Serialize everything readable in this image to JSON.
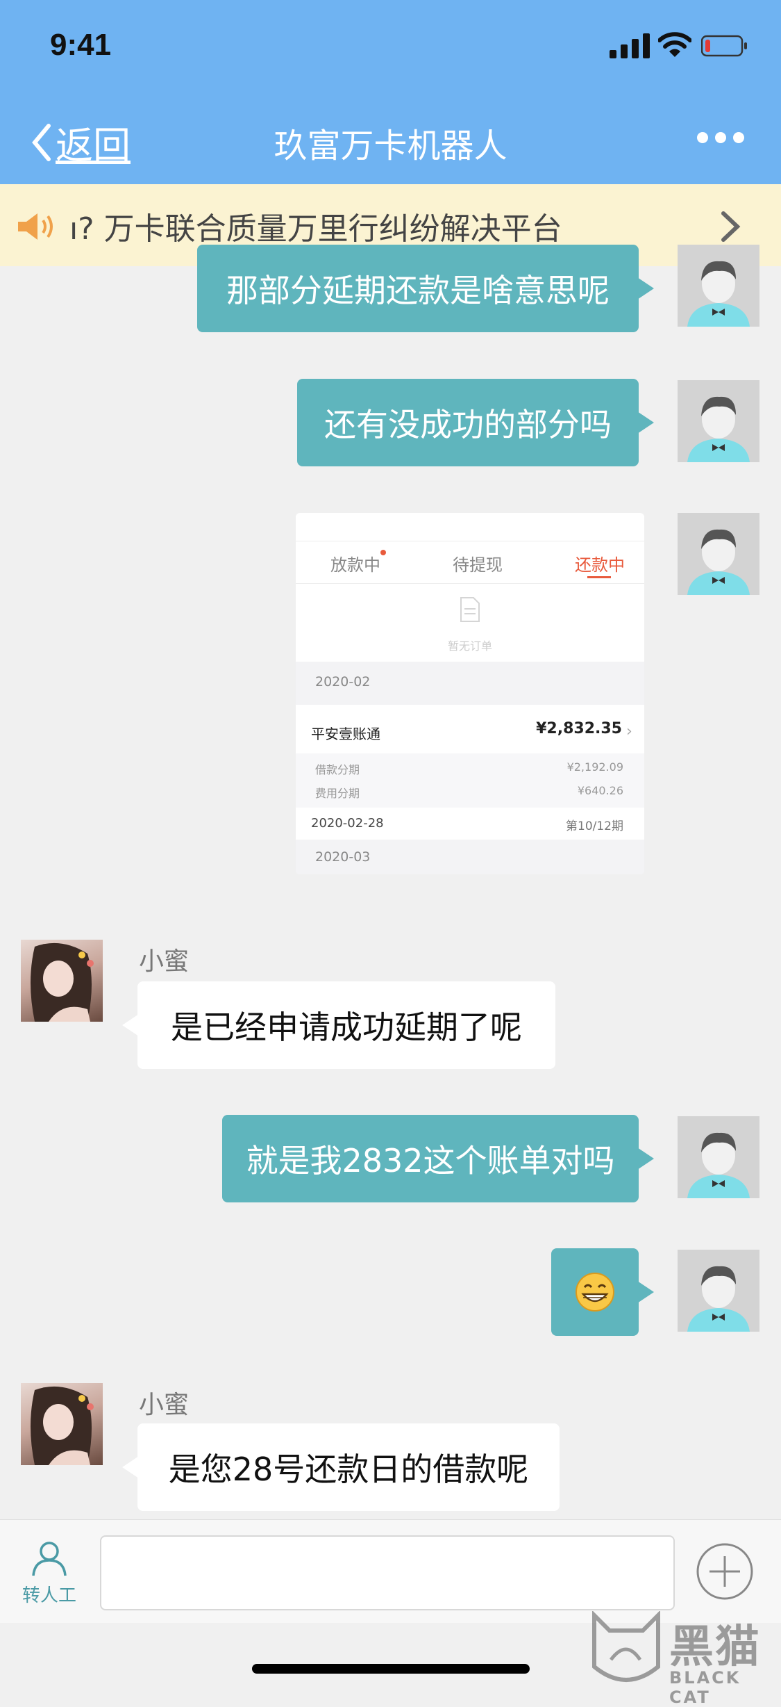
{
  "status_bar": {
    "time": "9:41"
  },
  "nav": {
    "back_label": "返回",
    "title": "玖富万卡机器人",
    "more_icon": "more-dots-icon"
  },
  "notice": {
    "text": "ı? 万卡联合质量万里行纠纷解决平台",
    "icon": "speaker-icon"
  },
  "messages": [
    {
      "from": "user",
      "text": "那部分延期还款是啥意思呢"
    },
    {
      "from": "user",
      "text": "还有没成功的部分吗"
    },
    {
      "from": "user",
      "type": "image"
    },
    {
      "from": "bot",
      "sender": "小蜜",
      "text": "是已经申请成功延期了呢"
    },
    {
      "from": "user",
      "text": "就是我2832这个账单对吗"
    },
    {
      "from": "user",
      "type": "emoji",
      "text": "😁"
    },
    {
      "from": "bot",
      "sender": "小蜜",
      "text": "是您28号还款日的借款呢"
    }
  ],
  "screenshot": {
    "tabs": [
      "放款中",
      "待提现",
      "还款中"
    ],
    "active_tab": "还款中",
    "empty_text": "暂无订单",
    "section1": "2020-02",
    "account": "平安壹账通",
    "amount": "¥2,832.35",
    "loan_label": "借款分期",
    "loan_amount": "¥2,192.09",
    "fee_label": "费用分期",
    "fee_amount": "¥640.26",
    "due_date": "2020-02-28",
    "period": "第10/12期",
    "section2": "2020-03"
  },
  "input_bar": {
    "agent_label": "转人工",
    "placeholder": ""
  },
  "watermark": {
    "main": "黑猫",
    "sub": "BLACK CAT"
  },
  "colors": {
    "header": "#6fb3f2",
    "user_bubble": "#5fb5bd",
    "accent": "#e85a3c"
  }
}
